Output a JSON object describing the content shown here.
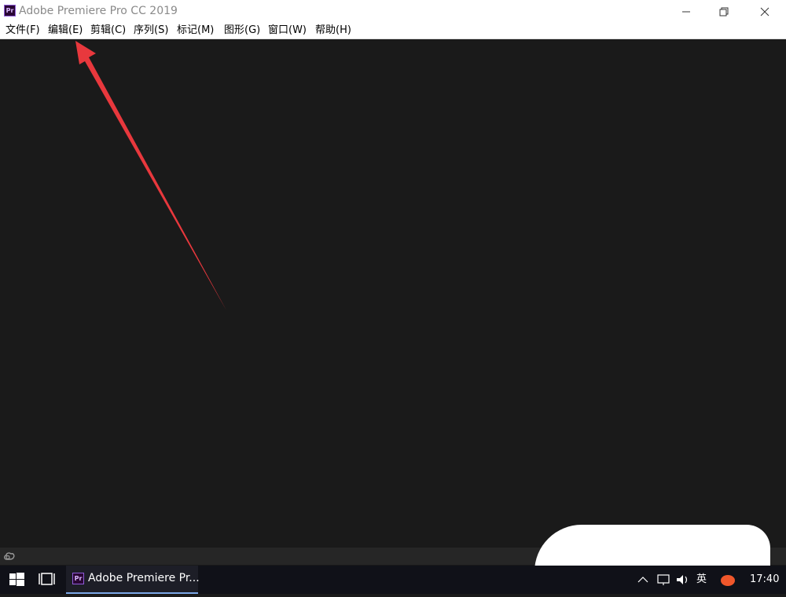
{
  "window": {
    "app_icon_text": "Pr",
    "title": "Adobe Premiere Pro CC 2019"
  },
  "menubar": {
    "items": [
      {
        "label": "文件(F)"
      },
      {
        "label": "编辑(E)"
      },
      {
        "label": "剪辑(C)"
      },
      {
        "label": "序列(S)"
      },
      {
        "label": "标记(M)"
      },
      {
        "label": "图形(G)"
      },
      {
        "label": "窗口(W)"
      },
      {
        "label": "帮助(H)"
      }
    ]
  },
  "statusbar": {
    "icon": "creative-cloud-icon"
  },
  "annotation": {
    "color": "#e8383d"
  },
  "taskbar": {
    "start_icon": "windows-start-icon",
    "taskview_icon": "task-view-icon",
    "active_app": {
      "icon_text": "Pr",
      "label": "Adobe Premiere Pr..."
    },
    "tray": {
      "ime_label": "英",
      "time": "17:40"
    }
  },
  "colors": {
    "workspace": "#1a1a1a",
    "taskbar": "#101118",
    "accent": "#7aa7e6"
  }
}
